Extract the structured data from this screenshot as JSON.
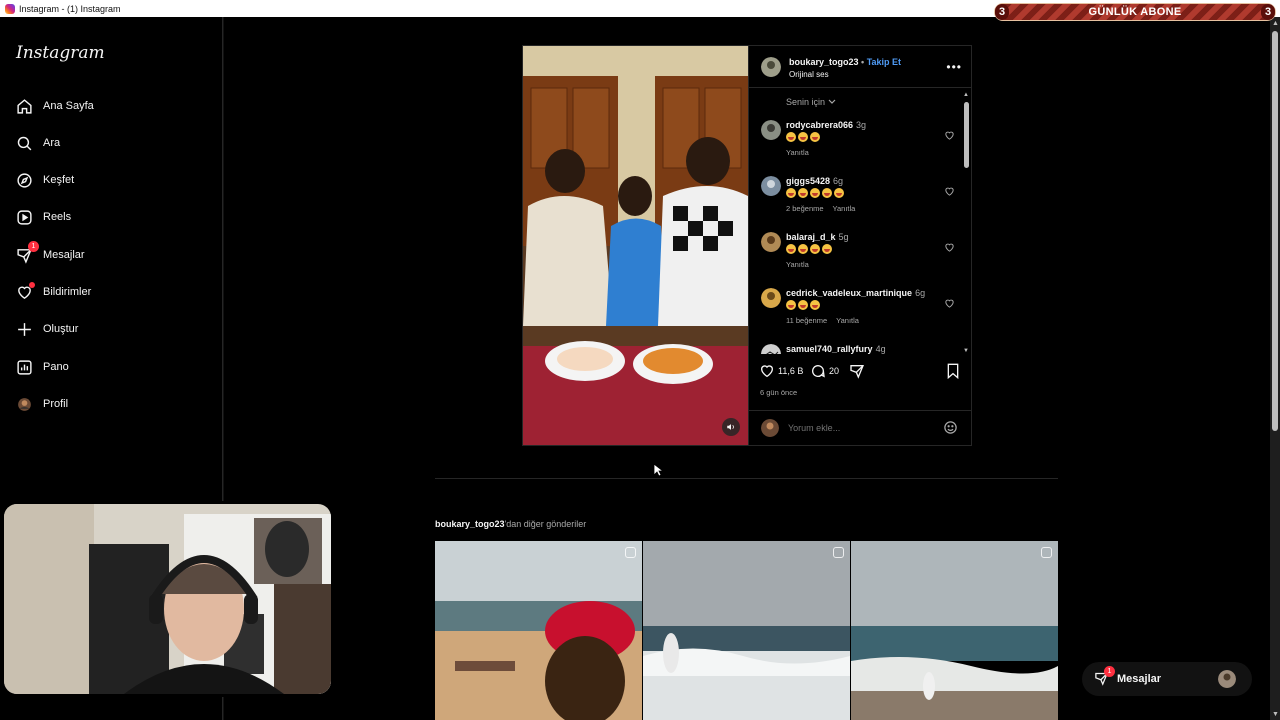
{
  "window": {
    "title": "Instagram - (1) Instagram"
  },
  "overlay": {
    "left_count": "3",
    "label": "GÜNLÜK ABONE",
    "right_count": "3"
  },
  "sidebar": {
    "logo": "Instagram",
    "items": [
      {
        "label": "Ana Sayfa",
        "icon": "home-icon"
      },
      {
        "label": "Ara",
        "icon": "search-icon"
      },
      {
        "label": "Keşfet",
        "icon": "compass-icon"
      },
      {
        "label": "Reels",
        "icon": "reels-icon"
      },
      {
        "label": "Mesajlar",
        "icon": "messenger-icon",
        "badge": "1"
      },
      {
        "label": "Bildirimler",
        "icon": "heart-icon"
      },
      {
        "label": "Oluştur",
        "icon": "plus-icon"
      },
      {
        "label": "Pano",
        "icon": "dashboard-icon"
      },
      {
        "label": "Profil",
        "icon": "profile-avatar"
      }
    ]
  },
  "post": {
    "username": "boukary_togo23",
    "separator": "•",
    "follow_label": "Takip Et",
    "audio": "Orijinal ses",
    "sort_label": "Senin için",
    "comments": [
      {
        "user": "rodycabrera066",
        "time": "3g",
        "emoji_count": 3,
        "likes": "",
        "reply": "Yanıtla"
      },
      {
        "user": "giggs5428",
        "time": "6g",
        "emoji_count": 5,
        "likes": "2 beğenme",
        "reply": "Yanıtla"
      },
      {
        "user": "balaraj_d_k",
        "time": "5g",
        "emoji_count": 4,
        "likes": "",
        "reply": "Yanıtla"
      },
      {
        "user": "cedrick_vadeleux_martinique",
        "time": "6g",
        "emoji_count": 3,
        "likes": "11 beğenme",
        "reply": "Yanıtla"
      },
      {
        "user": "samuel740_rallyfury",
        "time": "4g",
        "emoji_count": 0,
        "likes": "",
        "reply": ""
      }
    ],
    "like_count": "11,6 B",
    "comment_count": "20",
    "posted_ago": "6 gün önce",
    "comment_placeholder": "Yorum ekle..."
  },
  "more_posts": {
    "username": "boukary_togo23",
    "suffix": "'dan diğer gönderiler"
  },
  "messages_pill": {
    "label": "Mesajlar",
    "badge": "1"
  },
  "colors": {
    "accent_link": "#4f9bf5",
    "badge_red": "#ff3040",
    "background": "#000000"
  }
}
